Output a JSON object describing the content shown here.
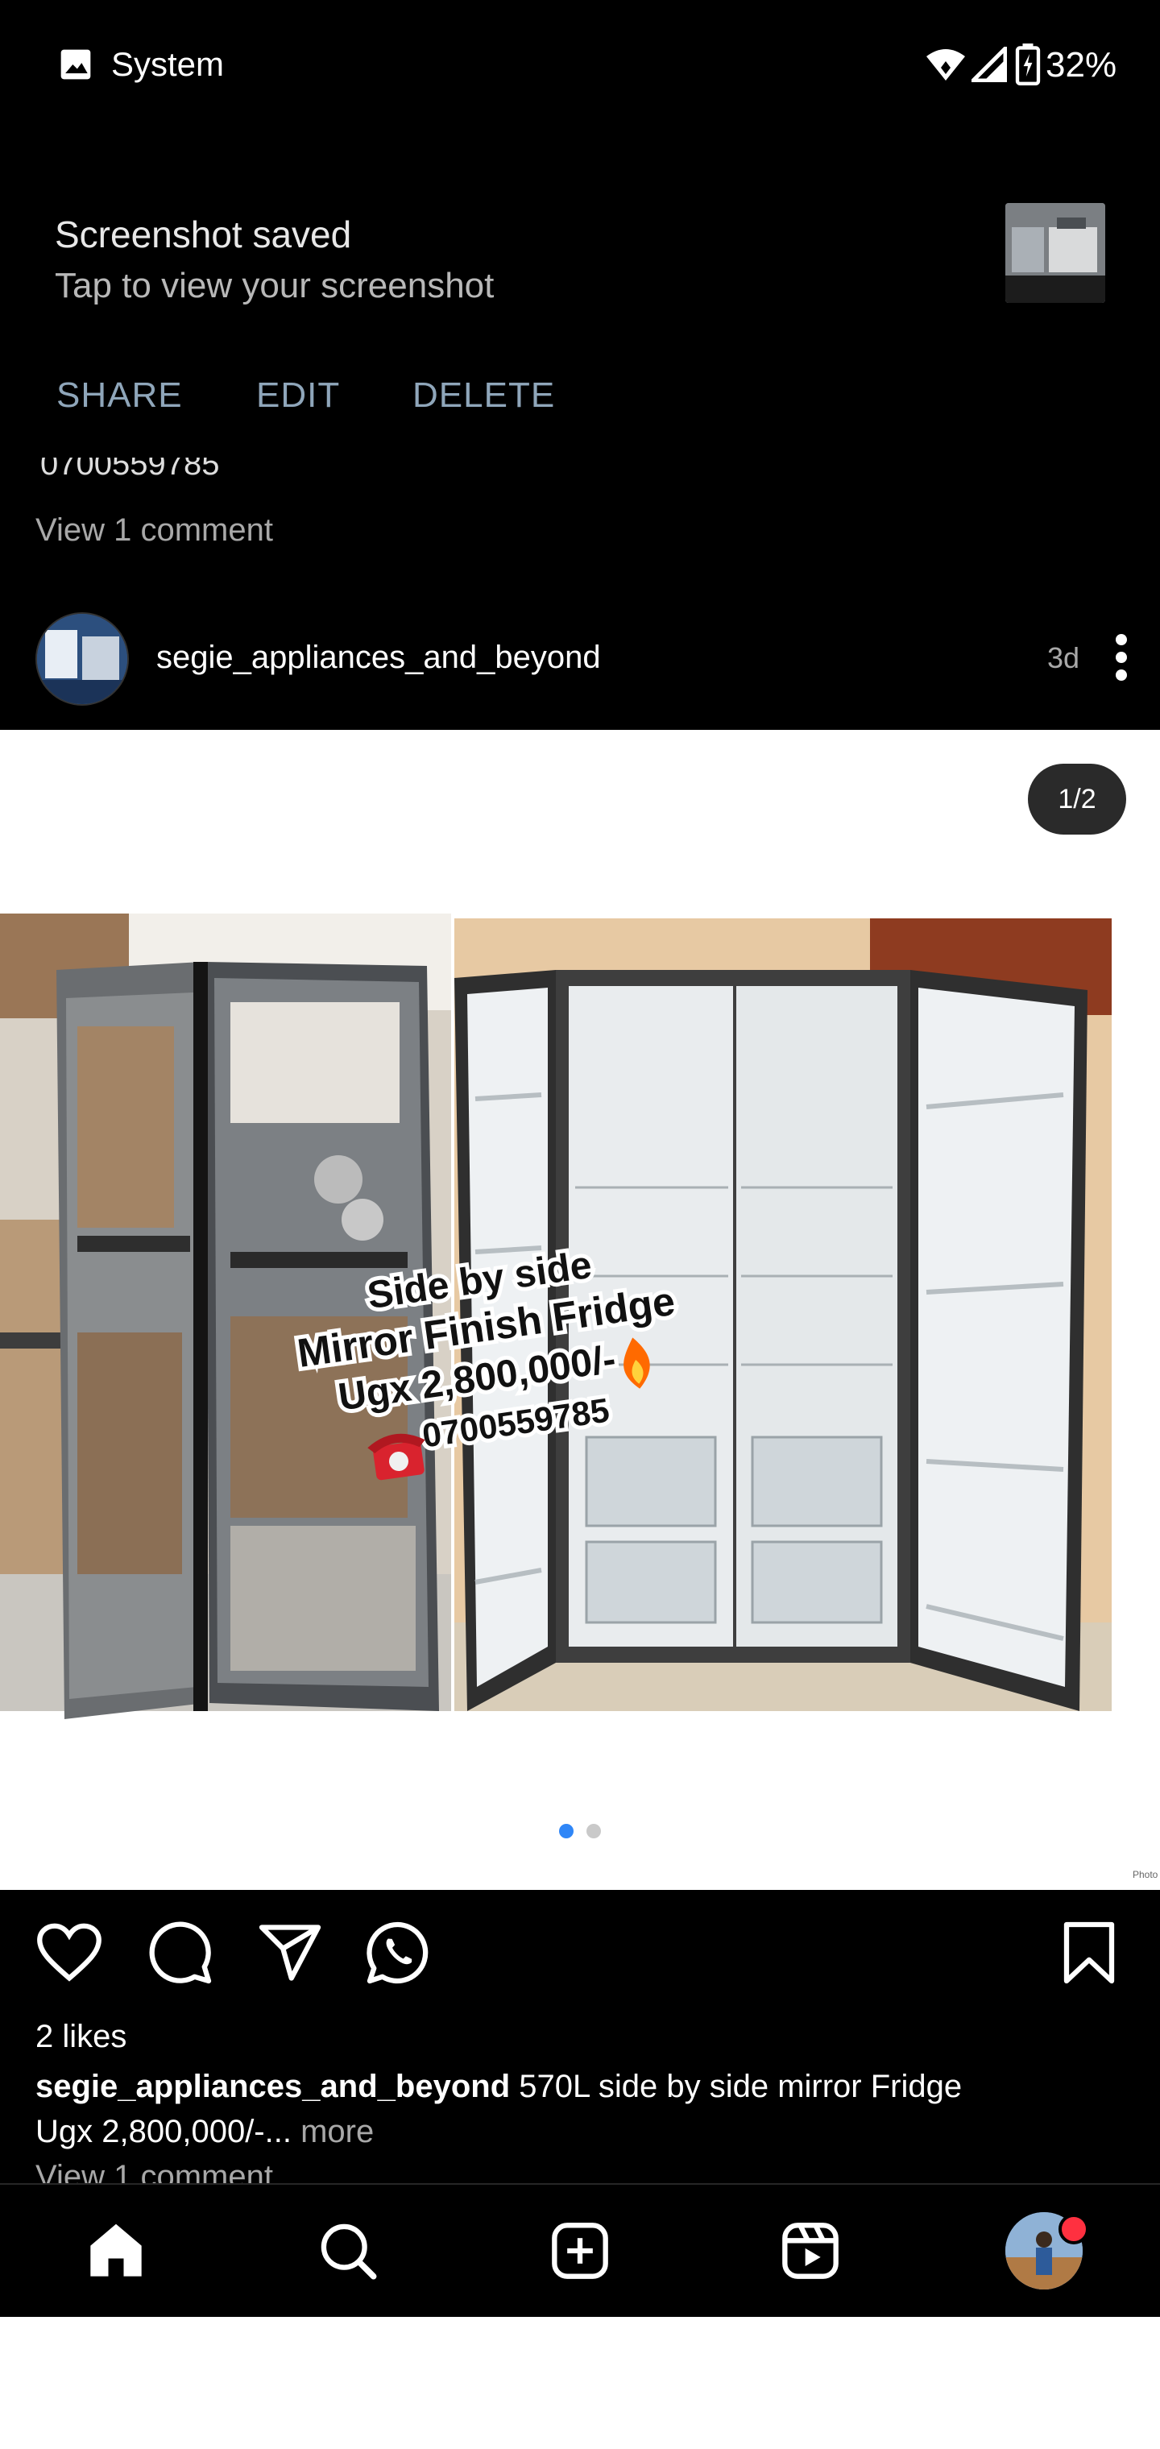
{
  "status_bar": {
    "app_label": "System",
    "battery_percent": "32%",
    "icons": [
      "image-icon",
      "wifi-icon",
      "signal-icon",
      "battery-icon"
    ]
  },
  "notification": {
    "title": "Screenshot saved",
    "subtitle": "Tap to view your screenshot",
    "actions": [
      "SHARE",
      "EDIT",
      "DELETE"
    ]
  },
  "previous_post": {
    "phone_line": "0700559785",
    "view_comments": "View 1 comment"
  },
  "post": {
    "username": "segie_appliances_and_beyond",
    "age": "3d",
    "counter": "1/2",
    "image_overlay": {
      "line1": "Side by side",
      "line2": "Mirror Finish Fridge",
      "line3": "Ugx 2,800,000/-",
      "line4": "0700559785"
    },
    "carousel_dots": 2,
    "active_dot": 1,
    "likes": "2 likes",
    "caption_user": "segie_appliances_and_beyond",
    "caption_text": "570L side by side mirror Fridge",
    "caption_line2": "Ugx 2,800,000/-...",
    "more_label": "more",
    "view_comments": "View 1 comment"
  },
  "bottom_nav": {
    "items": [
      "home-icon",
      "search-icon",
      "create-icon",
      "reels-icon",
      "profile-avatar"
    ]
  },
  "colors": {
    "background": "#000000",
    "accent_blue": "#2f86f7",
    "notification_action": "#8fa6ba",
    "badge_red": "#ff3040"
  }
}
